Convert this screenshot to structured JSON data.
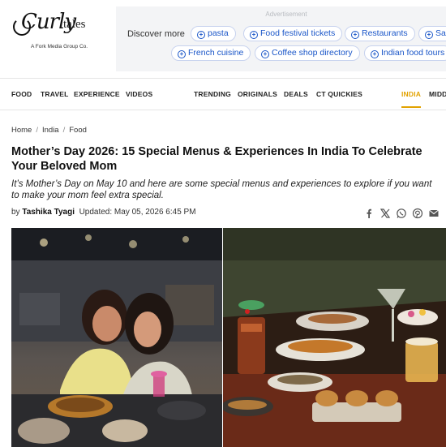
{
  "brand": {
    "name": "Curly Tales",
    "wordmark": "Curly",
    "wordmark_suffix": "tales",
    "tagline": "A Fork Media Group Co."
  },
  "ad": {
    "label": "Advertisement",
    "discover_label": "Discover more",
    "chips": [
      "pasta",
      "Food festival tickets",
      "Restaurants",
      "Saf",
      "French cuisine",
      "Coffee shop directory",
      "Indian food tours"
    ]
  },
  "nav": {
    "left": [
      "FOOD",
      "TRAVEL",
      "EXPERIENCE",
      "VIDEOS"
    ],
    "right": [
      "TRENDING",
      "ORIGINALS",
      "DEALS",
      "CT QUICKIES"
    ],
    "region_active": "INDIA",
    "region_next": "MIDDL"
  },
  "breadcrumb": [
    "Home",
    "India",
    "Food"
  ],
  "article": {
    "title": "Mother’s Day 2026: 15 Special Menus & Experiences In India To Celebrate Your Beloved Mom",
    "subtitle": "It’s Mother’s Day on May 10 and here are some special menus and experiences to explore if you want to make your mom feel extra special.",
    "by_prefix": "by",
    "author": "Tashika Tyagi",
    "updated": "Updated: May 05, 2026 6:45 PM"
  },
  "share_icons": [
    "facebook-icon",
    "x-icon",
    "whatsapp-icon",
    "pinterest-icon",
    "email-icon"
  ],
  "colors": {
    "accent_link": "#1a56c8",
    "active_nav": "#e2a200",
    "ad_bg": "#f3f4f6"
  }
}
